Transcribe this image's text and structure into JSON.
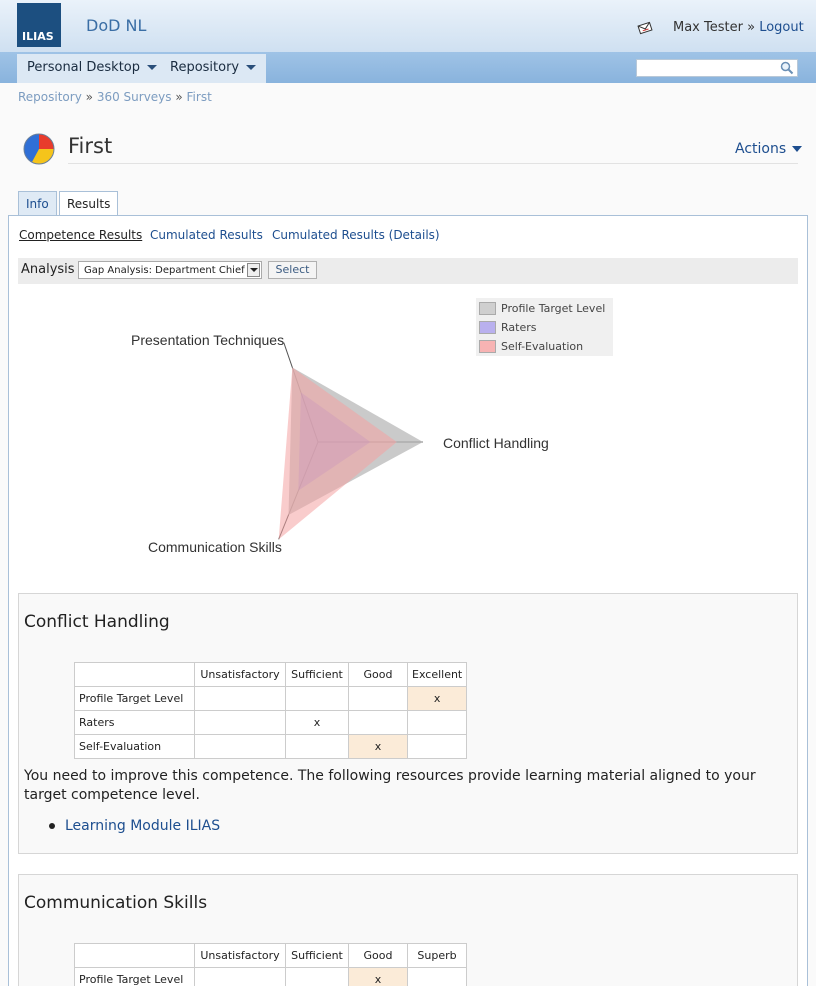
{
  "header": {
    "logo_text": "ILIAS",
    "installation": "DoD NL",
    "user_name": "Max Tester",
    "separator": "»",
    "logout_label": "Logout"
  },
  "nav": {
    "items": [
      {
        "label": "Personal Desktop"
      },
      {
        "label": "Repository"
      }
    ],
    "search_placeholder": ""
  },
  "breadcrumb": {
    "items": [
      "Repository",
      "360 Surveys",
      "First"
    ],
    "sep": "»"
  },
  "page": {
    "title": "First",
    "actions_label": "Actions"
  },
  "tabs": [
    {
      "label": "Info",
      "active": false
    },
    {
      "label": "Results",
      "active": true
    }
  ],
  "subtabs": [
    {
      "label": "Competence Results",
      "active": true
    },
    {
      "label": "Cumulated Results",
      "active": false
    },
    {
      "label": "Cumulated Results (Details)",
      "active": false
    }
  ],
  "analysis": {
    "label": "Analysis",
    "selected": "Gap Analysis: Department Chief",
    "button": "Select"
  },
  "chart_data": {
    "type": "radar",
    "axes": [
      "Presentation Techniques",
      "Conflict Handling",
      "Communication Skills"
    ],
    "max": 4,
    "series": [
      {
        "name": "Profile Target Level",
        "values": [
          3,
          4,
          3
        ],
        "color": "#b8b8b8"
      },
      {
        "name": "Raters",
        "values": [
          2,
          2,
          2
        ],
        "color": "#9d8fd8"
      },
      {
        "name": "Self-Evaluation",
        "values": [
          3,
          3,
          4
        ],
        "color": "#f4a3a3"
      }
    ],
    "legend_position": "top-right"
  },
  "competences": [
    {
      "title": "Conflict Handling",
      "levels": [
        "Unsatisfactory",
        "Sufficient",
        "Good",
        "Excellent"
      ],
      "rows": [
        {
          "label": "Profile Target Level",
          "level_index": 3
        },
        {
          "label": "Raters",
          "level_index": 1
        },
        {
          "label": "Self-Evaluation",
          "level_index": 2
        }
      ],
      "message": "You need to improve this competence. The following resources provide learning material aligned to your target competence level.",
      "resources": [
        "Learning Module ILIAS"
      ]
    },
    {
      "title": "Communication Skills",
      "levels": [
        "Unsatisfactory",
        "Sufficient",
        "Good",
        "Superb"
      ],
      "rows": [
        {
          "label": "Profile Target Level",
          "level_index": 2
        }
      ]
    }
  ],
  "mark_symbol": "x",
  "colors": {
    "link": "#1d4e8f",
    "header_bar": "#cfe0f1",
    "nav_bar": "#89b3dd",
    "mark_cell": "#fbebd8"
  }
}
